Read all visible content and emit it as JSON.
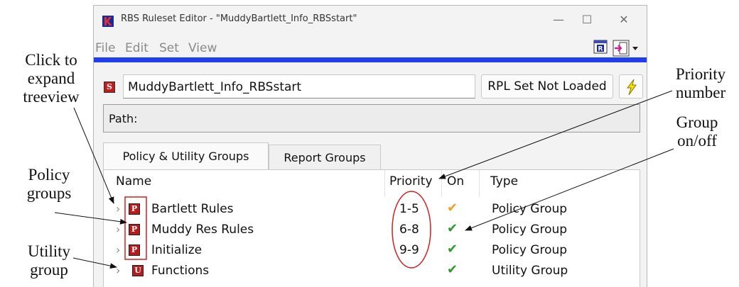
{
  "window": {
    "title": "RBS Ruleset Editor - \"MuddyBartlett_Info_RBSstart\"",
    "minimize_glyph": "—",
    "maximize_glyph": "☐",
    "close_glyph": "✕"
  },
  "menu": {
    "file": "File",
    "edit": "Edit",
    "set": "Set",
    "view": "View"
  },
  "ruleset": {
    "icon_letter": "S",
    "name": "MuddyBartlett_Info_RBSstart",
    "rpl_button": "RPL Set Not Loaded",
    "path_label": "Path:"
  },
  "tabs": [
    {
      "label": "Policy & Utility Groups",
      "active": true
    },
    {
      "label": "Report Groups",
      "active": false
    }
  ],
  "table": {
    "headers": {
      "name": "Name",
      "priority": "Priority",
      "on": "On",
      "type": "Type"
    },
    "rows": [
      {
        "name": "Bartlett Rules",
        "icon": "P",
        "priority": "1-5",
        "on": "✔",
        "on_color": "#f0a020",
        "type": "Policy Group"
      },
      {
        "name": "Muddy Res Rules",
        "icon": "P",
        "priority": "6-8",
        "on": "✔",
        "on_color": "#2e9a2e",
        "type": "Policy Group"
      },
      {
        "name": "Initialize",
        "icon": "P",
        "priority": "9-9",
        "on": "✔",
        "on_color": "#2e9a2e",
        "type": "Policy Group"
      },
      {
        "name": "Functions",
        "icon": "U",
        "priority": "",
        "on": "✔",
        "on_color": "#2e9a2e",
        "type": "Utility Group"
      }
    ],
    "chevron": "›"
  },
  "annotations": {
    "expand": [
      "Click to",
      "expand",
      "treeview"
    ],
    "policy": [
      "Policy",
      "groups"
    ],
    "utility": [
      "Utility",
      "group"
    ],
    "priority": [
      "Priority",
      "number"
    ],
    "group_onoff": [
      "Group",
      "on/off"
    ]
  },
  "colors": {
    "policy_icon": "#b71c1c",
    "utility_icon": "#b71c1c",
    "accent_bar": "#1f3ef0",
    "annotation_outline": "#d32020"
  }
}
